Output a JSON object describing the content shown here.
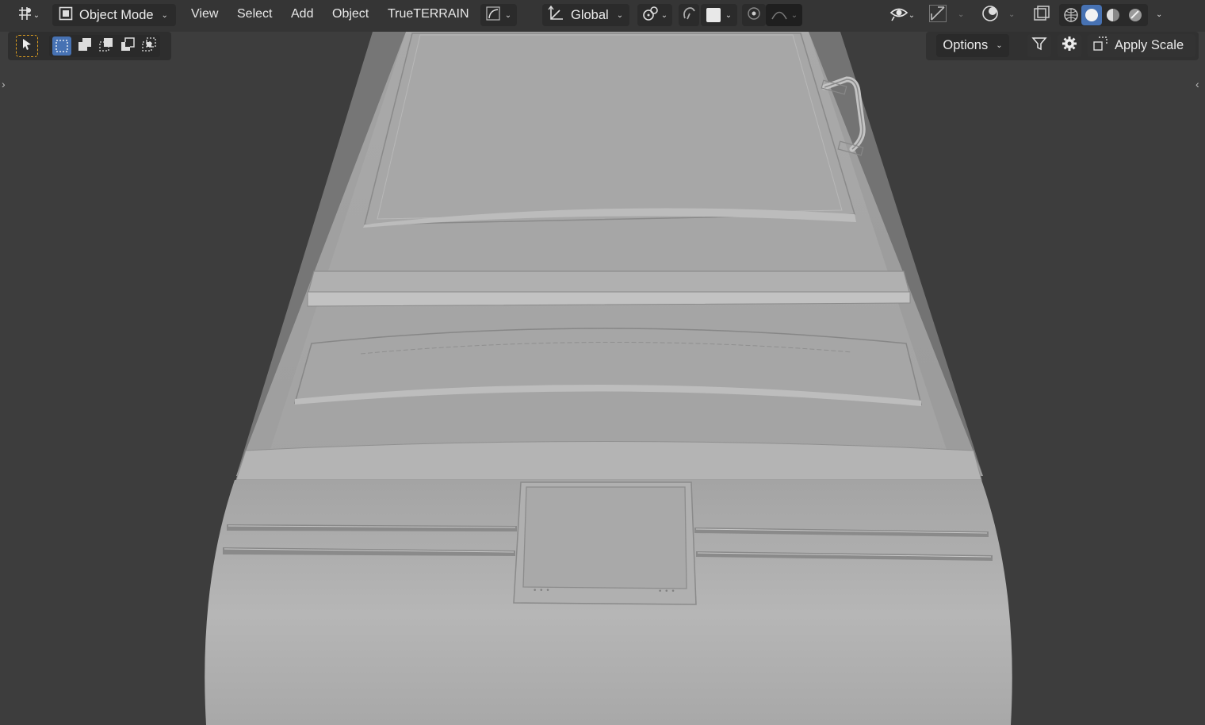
{
  "header": {
    "editor_type_icon": "grid-axes-icon",
    "mode": {
      "icon": "object-mode-icon",
      "label": "Object Mode"
    },
    "menus": [
      "View",
      "Select",
      "Add",
      "Object",
      "TrueTERRAIN"
    ],
    "transform_orientation": {
      "icon": "orientation-axes-icon",
      "label": "Global"
    },
    "pivot_icon": "pivot-point-icon",
    "snap_icon": "snap-magnet-icon",
    "proportional_edit_icon": "proportional-edit-icon",
    "falloff_icon": "falloff-curve-icon",
    "right_icons": [
      "eye-visibility-icon",
      "gizmo-icon",
      "overlay-icon",
      "xray-icon",
      "wireframe-shading-icon",
      "solid-shading-icon",
      "material-shading-icon",
      "rendered-shading-icon"
    ],
    "active_shading": "solid"
  },
  "toolbar_row": {
    "select_tool_icon": "cursor-select-icon",
    "select_modes": [
      "select-new-icon",
      "select-extend-icon",
      "select-subtract-icon",
      "select-invert-icon",
      "select-intersect-icon"
    ],
    "options_label": "Options",
    "filter_icon": "filter-funnel-icon",
    "settings_icon": "gear-icon",
    "apply_scale": {
      "icon": "apply-scale-icon",
      "label": "Apply Scale"
    }
  },
  "colors": {
    "viewport_bg": "#3d3d3d",
    "model": "#a9a9a9",
    "accent": "#4772b3",
    "select_outline": "#e0a020"
  }
}
